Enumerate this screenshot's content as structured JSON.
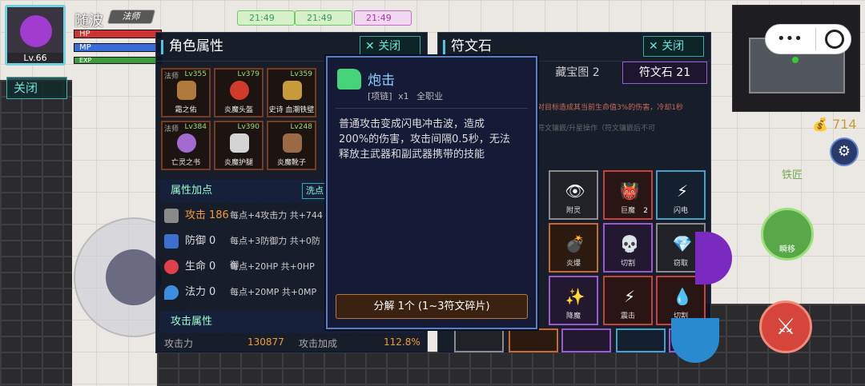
{
  "player": {
    "name": "随波",
    "title": "法师",
    "level": "Lv.66",
    "hp_label": "HP",
    "mp_label": "MP",
    "exp_label": "EXP"
  },
  "timers": [
    "21:49",
    "21:49",
    "21:49"
  ],
  "left_close": "关闭",
  "char_panel": {
    "title": "角色属性",
    "close": "关闭",
    "equipment": [
      {
        "tag": "法师",
        "level": "Lv355",
        "name": "霜之佑"
      },
      {
        "tag": "",
        "level": "Lv379",
        "name": "炎魔头盔"
      },
      {
        "tag": "",
        "level": "Lv359",
        "name": "史诗 血潮铁壁"
      },
      {
        "tag": "法师",
        "level": "Lv384",
        "name": "亡灵之书"
      },
      {
        "tag": "",
        "level": "Lv390",
        "name": "炎魔护腿"
      },
      {
        "tag": "",
        "level": "Lv248",
        "name": "炎魔靴子"
      }
    ],
    "bonus_header": "属性加点",
    "wash_btn": "洗点",
    "attributes": [
      {
        "name": "攻击",
        "value": "186",
        "desc": "每点+4攻击力 共+744"
      },
      {
        "name": "防御",
        "value": "0",
        "desc": "每点+3防御力 共+0防御"
      },
      {
        "name": "生命",
        "value": "0",
        "desc": "每点+20HP 共+0HP"
      },
      {
        "name": "法力",
        "value": "0",
        "desc": "每点+20MP 共+0MP"
      }
    ],
    "attack_header": "攻击属性",
    "attack_power_label": "攻击力",
    "attack_power_value": "130877",
    "attack_bonus_label": "攻击加成",
    "attack_bonus_value": "112.8%"
  },
  "rune_panel": {
    "title": "符文石",
    "close": "关闭",
    "tab_map": "藏宝图 2",
    "tab_rune": "符文石 21",
    "hint1": "对目标造成其当前生命值3%的伤害，冷却1秒",
    "hint2": "符文镶嵌/升星操作（符文镶嵌后不可",
    "runes": [
      {
        "name": "附灵",
        "icon": "👁",
        "style": "grey"
      },
      {
        "name": "巨魔",
        "icon": "👹",
        "style": "red",
        "count": "2"
      },
      {
        "name": "闪电",
        "icon": "⚡",
        "style": ""
      },
      {
        "name": "炎爆",
        "icon": "💣",
        "style": "orange"
      },
      {
        "name": "切割",
        "icon": "💀",
        "style": "purple"
      },
      {
        "name": "窃取",
        "icon": "💎",
        "style": "grey"
      },
      {
        "name": "降魔",
        "icon": "✨",
        "style": "purple"
      },
      {
        "name": "震击",
        "icon": "⚡",
        "style": "red"
      },
      {
        "name": "切割",
        "icon": "💧",
        "style": "red"
      }
    ]
  },
  "tooltip": {
    "name": "炮击",
    "slot": "[项链]",
    "qty": "x1",
    "job": "全职业",
    "description": "普通攻击变成闪电冲击波，造成200%的伤害，攻击间隔0.5秒，无法释放主武器和副武器携带的技能",
    "decompose": "分解 1个 (1~3符文碎片)"
  },
  "gold": "714",
  "npc_label": "铁匠",
  "skill_label": "瞬移"
}
